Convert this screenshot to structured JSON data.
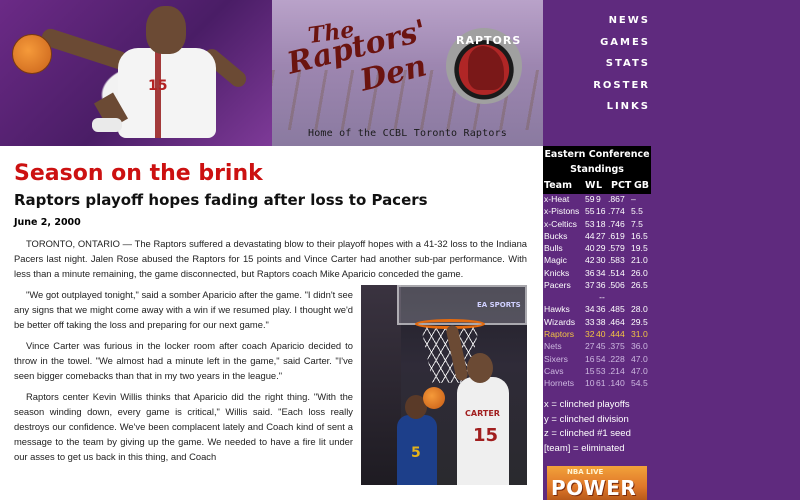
{
  "banner": {
    "title_the": "The",
    "title_raptors": "Raptors'",
    "title_den": "Den",
    "logo_text": "RAPTORS",
    "subtitle": "Home of the CCBL Toronto Raptors",
    "player_number": "15"
  },
  "nav": {
    "items": [
      {
        "label": "NEWS"
      },
      {
        "label": "GAMES"
      },
      {
        "label": "STATS"
      },
      {
        "label": "ROSTER"
      },
      {
        "label": "LINKS"
      }
    ]
  },
  "article": {
    "headline": "Season on the brink",
    "subheadline": "Raptors playoff hopes fading after loss to Pacers",
    "date": "June 2, 2000",
    "paragraphs": [
      "TORONTO, ONTARIO — The Raptors suffered a devastating blow to their playoff hopes with a 41-32 loss to the Indiana Pacers last night. Jalen Rose abused the Raptors for 15 points and Vince Carter had another sub-par performance. With less than a minute remaining, the game disconnected, but Raptors coach Mike Aparicio conceded the game.",
      "\"We got outplayed tonight,\" said a somber Aparicio after the game. \"I didn't see any signs that we might come away with a win if we resumed play. I thought we'd be better off taking the loss and preparing for our next game.\"",
      "Vince Carter was furious in the locker room after coach Aparicio decided to throw in the towel. \"We almost had a minute left in the game,\" said Carter. \"I've seen bigger comebacks than that in my two years in the league.\"",
      "Raptors center Kevin Willis thinks that Aparicio did the right thing. \"With the season winding down, every game is critical,\" Willis said. \"Each loss really destroys our confidence. We've been complacent lately and Coach kind of sent a message to the team by giving up the game. We needed to have a fire lit under our asses to get us back in this thing, and Coach"
    ],
    "photo": {
      "dunker_name": "CARTER",
      "dunker_number": "15",
      "defender_number": "5",
      "ad_text": "EA SPORTS"
    }
  },
  "standings": {
    "title_line1": "Eastern Conference",
    "title_line2": "Standings",
    "columns": {
      "team": "Team",
      "w": "W",
      "l": "L",
      "pct": "PCT",
      "gb": "GB"
    },
    "group1": [
      {
        "team": "x-Heat",
        "w": "59",
        "l": "9",
        "pct": ".867",
        "gb": "–"
      },
      {
        "team": "x-Pistons",
        "w": "55",
        "l": "16",
        "pct": ".774",
        "gb": "5.5"
      },
      {
        "team": "x-Celtics",
        "w": "53",
        "l": "18",
        "pct": ".746",
        "gb": "7.5"
      },
      {
        "team": "Bucks",
        "w": "44",
        "l": "27",
        "pct": ".619",
        "gb": "16.5"
      },
      {
        "team": "Bulls",
        "w": "40",
        "l": "29",
        "pct": ".579",
        "gb": "19.5"
      },
      {
        "team": "Magic",
        "w": "42",
        "l": "30",
        "pct": ".583",
        "gb": "21.0"
      },
      {
        "team": "Knicks",
        "w": "36",
        "l": "34",
        "pct": ".514",
        "gb": "26.0"
      },
      {
        "team": "Pacers",
        "w": "37",
        "l": "36",
        "pct": ".506",
        "gb": "26.5"
      }
    ],
    "divider": "--",
    "group2": [
      {
        "team": "Hawks",
        "w": "34",
        "l": "36",
        "pct": ".485",
        "gb": "28.0",
        "style": "normal"
      },
      {
        "team": "Wizards",
        "w": "33",
        "l": "38",
        "pct": ".464",
        "gb": "29.5",
        "style": "normal"
      },
      {
        "team": "Raptors",
        "w": "32",
        "l": "40",
        "pct": ".444",
        "gb": "31.0",
        "style": "highlight"
      },
      {
        "team": "Nets",
        "w": "27",
        "l": "45",
        "pct": ".375",
        "gb": "36.0",
        "style": "dim"
      },
      {
        "team": "Sixers",
        "w": "16",
        "l": "54",
        "pct": ".228",
        "gb": "47.0",
        "style": "dim"
      },
      {
        "team": "Cavs",
        "w": "15",
        "l": "53",
        "pct": ".214",
        "gb": "47.0",
        "style": "dim"
      },
      {
        "team": "Hornets",
        "w": "10",
        "l": "61",
        "pct": ".140",
        "gb": "54.5",
        "style": "dim"
      }
    ],
    "legend": [
      "x = clinched playoffs",
      "y = clinched division",
      "z = clinched #1 seed",
      "[team] = eliminated"
    ]
  },
  "promo": {
    "label": "POWER",
    "top_text": "NBA LIVE"
  },
  "colors": {
    "background": "#5f2a7e",
    "headline": "#cc1111",
    "highlight_team": "#f4c542"
  }
}
